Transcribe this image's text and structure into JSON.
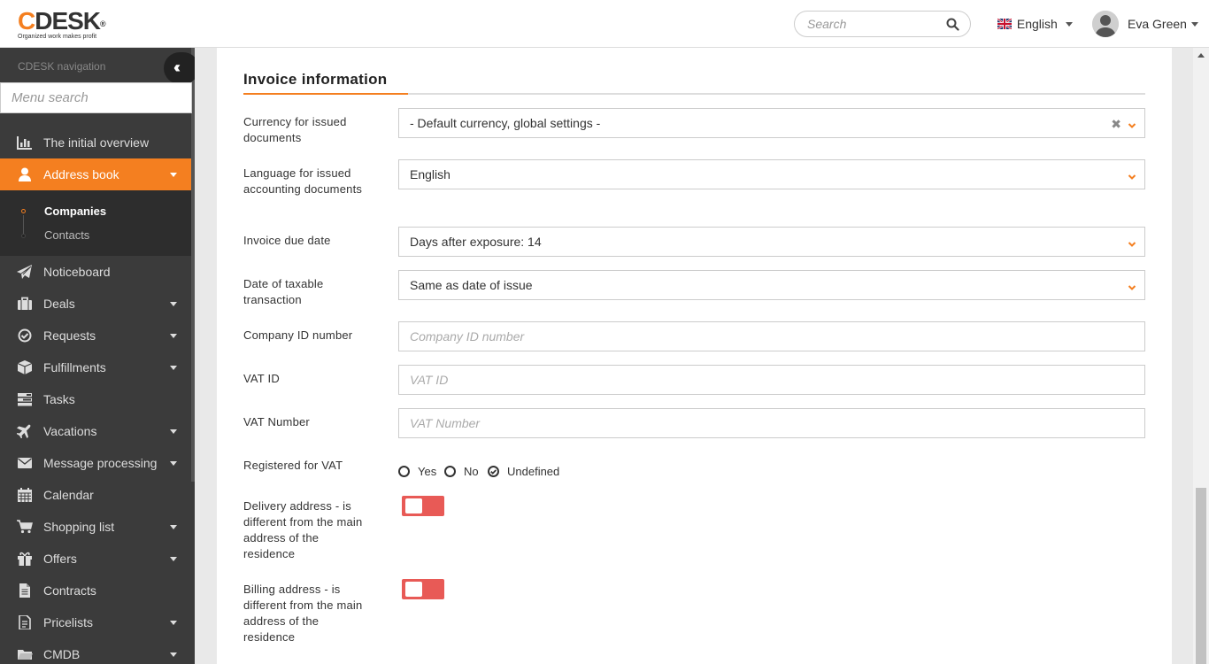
{
  "app": {
    "logo_text": "CDESK",
    "logo_registered": "®",
    "logo_tagline": "Organized work makes profit",
    "brand_color": "#f47f20"
  },
  "header": {
    "search_placeholder": "Search",
    "language": "English",
    "user_name": "Eva Green"
  },
  "sidebar": {
    "heading": "CDESK navigation",
    "menu_search_placeholder": "Menu search",
    "items": [
      {
        "label": "The initial overview",
        "icon": "chart-icon",
        "caret": false,
        "active": false
      },
      {
        "label": "Address book",
        "icon": "user-icon",
        "caret": true,
        "active": true
      },
      {
        "label": "Noticeboard",
        "icon": "paper-plane-icon",
        "caret": false,
        "active": false
      },
      {
        "label": "Deals",
        "icon": "briefcase-icon",
        "caret": true,
        "active": false
      },
      {
        "label": "Requests",
        "icon": "check-circle-icon",
        "caret": true,
        "active": false
      },
      {
        "label": "Fulfillments",
        "icon": "cube-icon",
        "caret": true,
        "active": false
      },
      {
        "label": "Tasks",
        "icon": "tasks-icon",
        "caret": false,
        "active": false
      },
      {
        "label": "Vacations",
        "icon": "plane-icon",
        "caret": true,
        "active": false
      },
      {
        "label": "Message processing",
        "icon": "envelope-icon",
        "caret": true,
        "active": false
      },
      {
        "label": "Calendar",
        "icon": "calendar-icon",
        "caret": false,
        "active": false
      },
      {
        "label": "Shopping list",
        "icon": "cart-icon",
        "caret": true,
        "active": false
      },
      {
        "label": "Offers",
        "icon": "gift-icon",
        "caret": true,
        "active": false
      },
      {
        "label": "Contracts",
        "icon": "document-icon",
        "caret": false,
        "active": false
      },
      {
        "label": "Pricelists",
        "icon": "pricelist-icon",
        "caret": true,
        "active": false
      },
      {
        "label": "CMDB",
        "icon": "folder-icon",
        "caret": true,
        "active": false
      }
    ],
    "submenu": [
      {
        "label": "Companies",
        "current": true
      },
      {
        "label": "Contacts",
        "current": false
      }
    ]
  },
  "form": {
    "section_title": "Invoice information",
    "currency_label": "Currency for issued documents",
    "currency_value": "- Default currency, global settings -",
    "language_label": "Language for issued accounting documents",
    "language_value": "English",
    "due_label": "Invoice due date",
    "due_value": "Days after exposure: 14",
    "taxable_label": "Date of taxable transaction",
    "taxable_value": "Same as date of issue",
    "company_id_label": "Company ID number",
    "company_id_placeholder": "Company ID number",
    "vat_id_label": "VAT ID",
    "vat_id_placeholder": "VAT ID",
    "vat_number_label": "VAT Number",
    "vat_number_placeholder": "VAT Number",
    "vat_registered_label": "Registered for VAT",
    "vat_options": [
      "Yes",
      "No",
      "Undefined"
    ],
    "vat_selected": "Undefined",
    "delivery_label": "Delivery address - is different from the main address of the residence",
    "delivery_enabled": false,
    "billing_label": "Billing address - is different from the main address of the residence",
    "billing_enabled": false
  }
}
